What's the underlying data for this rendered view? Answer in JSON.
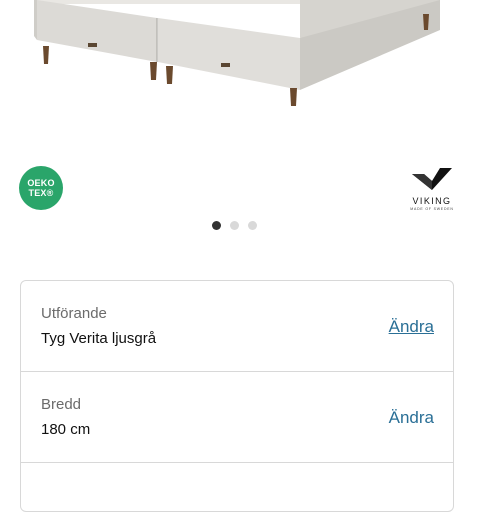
{
  "product_images": {
    "active_index": 0,
    "count": 3
  },
  "badges": {
    "oeko_line1": "OEKO",
    "oeko_line2": "TEX®",
    "viking_name": "VIKING",
    "viking_tagline": "MADE OF SWEDEN"
  },
  "options": [
    {
      "label": "Utförande",
      "value": "Tyg Verita ljusgrå",
      "action": "Ändra"
    },
    {
      "label": "Bredd",
      "value": "180 cm",
      "action": "Ändra"
    }
  ]
}
